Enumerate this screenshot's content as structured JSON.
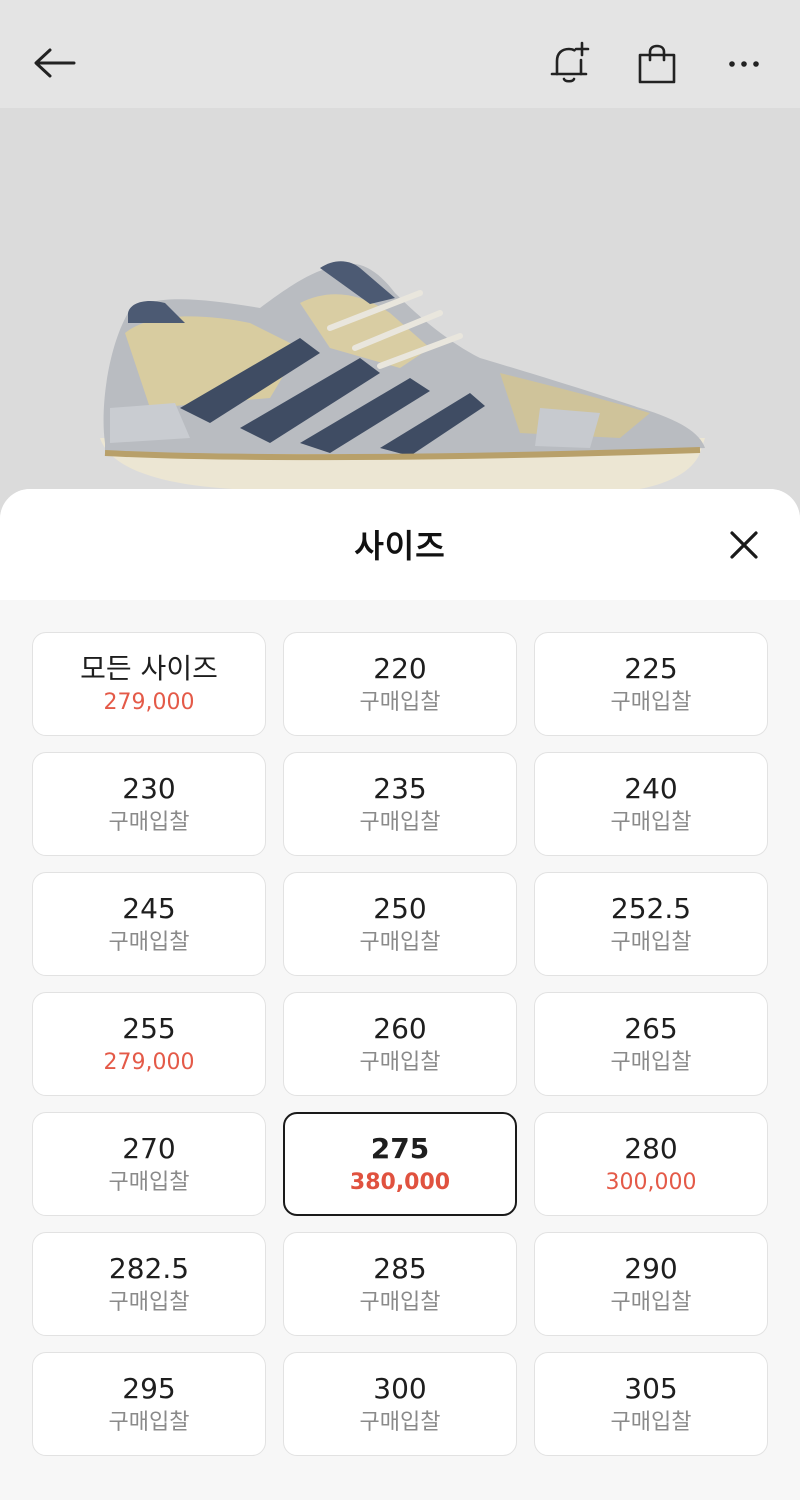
{
  "sheet": {
    "title": "사이즈"
  },
  "sizes": [
    {
      "size": "모든 사이즈",
      "sub": "279,000",
      "type": "price"
    },
    {
      "size": "220",
      "sub": "구매입찰",
      "type": "bid"
    },
    {
      "size": "225",
      "sub": "구매입찰",
      "type": "bid"
    },
    {
      "size": "230",
      "sub": "구매입찰",
      "type": "bid"
    },
    {
      "size": "235",
      "sub": "구매입찰",
      "type": "bid"
    },
    {
      "size": "240",
      "sub": "구매입찰",
      "type": "bid"
    },
    {
      "size": "245",
      "sub": "구매입찰",
      "type": "bid"
    },
    {
      "size": "250",
      "sub": "구매입찰",
      "type": "bid"
    },
    {
      "size": "252.5",
      "sub": "구매입찰",
      "type": "bid"
    },
    {
      "size": "255",
      "sub": "279,000",
      "type": "price"
    },
    {
      "size": "260",
      "sub": "구매입찰",
      "type": "bid"
    },
    {
      "size": "265",
      "sub": "구매입찰",
      "type": "bid"
    },
    {
      "size": "270",
      "sub": "구매입찰",
      "type": "bid"
    },
    {
      "size": "275",
      "sub": "380,000",
      "type": "price",
      "selected": true
    },
    {
      "size": "280",
      "sub": "300,000",
      "type": "price"
    },
    {
      "size": "282.5",
      "sub": "구매입찰",
      "type": "bid"
    },
    {
      "size": "285",
      "sub": "구매입찰",
      "type": "bid"
    },
    {
      "size": "290",
      "sub": "구매입찰",
      "type": "bid"
    },
    {
      "size": "295",
      "sub": "구매입찰",
      "type": "bid"
    },
    {
      "size": "300",
      "sub": "구매입찰",
      "type": "bid"
    },
    {
      "size": "305",
      "sub": "구매입찰",
      "type": "bid"
    }
  ],
  "colors": {
    "price": "#e45a48",
    "selected_border": "#1a1a1a",
    "bid_text": "#8a8a8a"
  },
  "icons": {
    "back": "arrow-left-icon",
    "alert": "bell-plus-icon",
    "cart": "shopping-bag-icon",
    "more": "more-horizontal-icon",
    "close": "close-icon"
  }
}
